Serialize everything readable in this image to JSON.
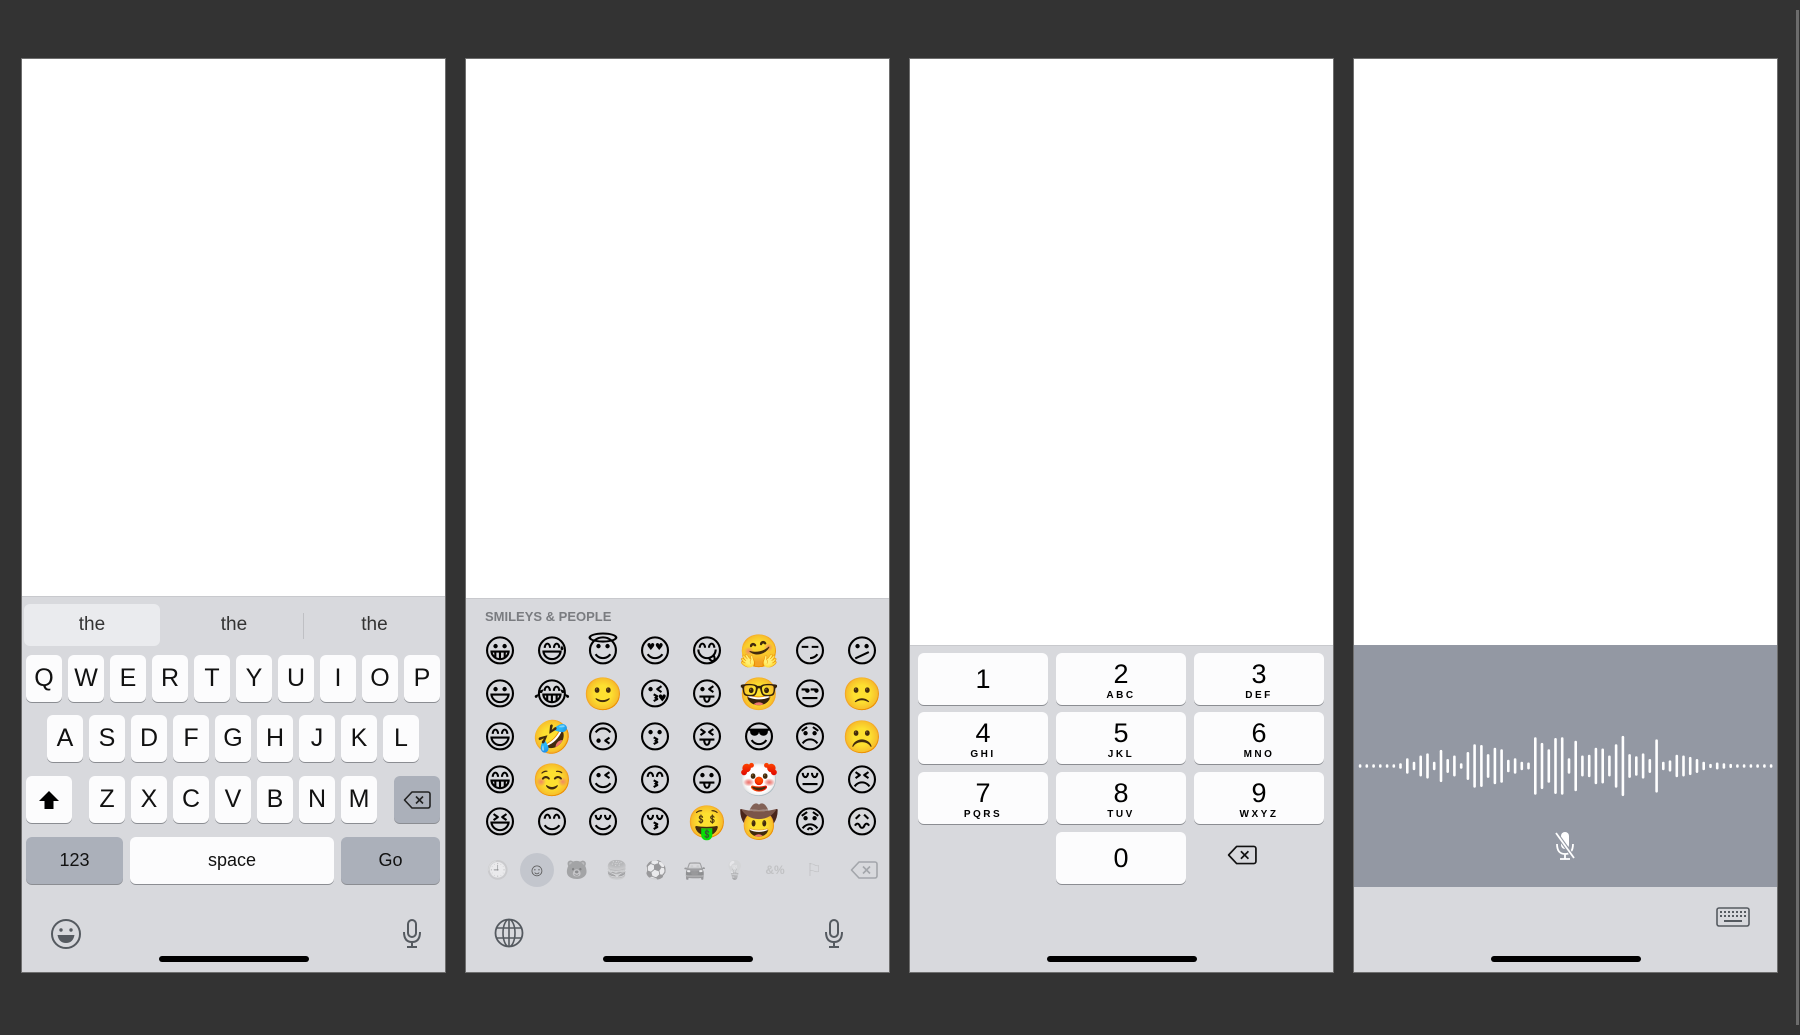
{
  "panels": {
    "alpha": {
      "suggestions": [
        "the",
        "the",
        "the"
      ],
      "rows": [
        [
          "Q",
          "W",
          "E",
          "R",
          "T",
          "Y",
          "U",
          "I",
          "O",
          "P"
        ],
        [
          "A",
          "S",
          "D",
          "F",
          "G",
          "H",
          "J",
          "K",
          "L"
        ],
        [
          "Z",
          "X",
          "C",
          "V",
          "B",
          "N",
          "M"
        ]
      ],
      "numbers_key": "123",
      "space_key": "space",
      "return_key": "Go",
      "shift_icon": "shift-icon",
      "delete_icon": "delete-icon",
      "bottom_left_icon": "emoji-icon",
      "bottom_right_icon": "microphone-icon"
    },
    "emoji": {
      "section_title": "SMILEYS & PEOPLE",
      "grid": [
        [
          "😀",
          "😅",
          "😇",
          "😍",
          "😋",
          "🤗",
          "😏",
          "😕"
        ],
        [
          "😃",
          "😂",
          "🙂",
          "😘",
          "😜",
          "🤓",
          "😒",
          "🙁"
        ],
        [
          "😄",
          "🤣",
          "🙃",
          "😗",
          "😝",
          "😎",
          "😞",
          "☹️"
        ],
        [
          "😁",
          "☺️",
          "😉",
          "😙",
          "😛",
          "🤡",
          "😔",
          "😣"
        ],
        [
          "😆",
          "😊",
          "😌",
          "😚",
          "🤑",
          "🤠",
          "😟",
          "😖"
        ]
      ],
      "categories": [
        {
          "name": "recent",
          "icon": "clock-icon",
          "glyph": "🕘",
          "selected": false
        },
        {
          "name": "smileys",
          "icon": "smiley-icon",
          "glyph": "☺",
          "selected": true
        },
        {
          "name": "animals",
          "icon": "bear-icon",
          "glyph": "🐻",
          "selected": false
        },
        {
          "name": "food",
          "icon": "food-icon",
          "glyph": "🍔",
          "selected": false
        },
        {
          "name": "activity",
          "icon": "ball-icon",
          "glyph": "⚽",
          "selected": false
        },
        {
          "name": "travel",
          "icon": "car-icon",
          "glyph": "🚘",
          "selected": false
        },
        {
          "name": "objects",
          "icon": "lightbulb-icon",
          "glyph": "💡",
          "selected": false
        },
        {
          "name": "symbols",
          "icon": "symbols-icon",
          "glyph": "&%",
          "selected": false
        },
        {
          "name": "flags",
          "icon": "flag-icon",
          "glyph": "⚐",
          "selected": false
        }
      ],
      "delete_icon": "delete-icon",
      "bottom_left_icon": "globe-icon",
      "bottom_right_icon": "microphone-icon"
    },
    "numpad": {
      "keys": [
        {
          "digit": "1",
          "letters": ""
        },
        {
          "digit": "2",
          "letters": "ABC"
        },
        {
          "digit": "3",
          "letters": "DEF"
        },
        {
          "digit": "4",
          "letters": "GHI"
        },
        {
          "digit": "5",
          "letters": "JKL"
        },
        {
          "digit": "6",
          "letters": "MNO"
        },
        {
          "digit": "7",
          "letters": "PQRS"
        },
        {
          "digit": "8",
          "letters": "TUV"
        },
        {
          "digit": "9",
          "letters": "WXYZ"
        },
        {
          "digit": "0",
          "letters": ""
        }
      ],
      "delete_icon": "delete-icon"
    },
    "dictation": {
      "waveform_levels": [
        0.05,
        0.05,
        0.05,
        0.05,
        0.05,
        0.05,
        0.08,
        0.22,
        0.12,
        0.3,
        0.36,
        0.12,
        0.46,
        0.2,
        0.3,
        0.08,
        0.4,
        0.62,
        0.6,
        0.34,
        0.52,
        0.48,
        0.18,
        0.22,
        0.12,
        0.1,
        0.82,
        0.66,
        0.48,
        0.8,
        0.82,
        0.22,
        0.72,
        0.3,
        0.32,
        0.52,
        0.5,
        0.3,
        0.62,
        0.86,
        0.34,
        0.28,
        0.36,
        0.2,
        0.76,
        0.12,
        0.16,
        0.32,
        0.3,
        0.26,
        0.2,
        0.12,
        0.06,
        0.1,
        0.08,
        0.06,
        0.05,
        0.05,
        0.05,
        0.05,
        0.05,
        0.05
      ],
      "mic_icon": "microphone-off-icon",
      "keyboard_icon": "keyboard-icon"
    }
  },
  "colors": {
    "background": "#333333",
    "keyboard_bg": "#d8d9dd",
    "key": "#fcfcfd",
    "dark_key": "#abb0ba",
    "dictation_bg": "#9398a3"
  }
}
